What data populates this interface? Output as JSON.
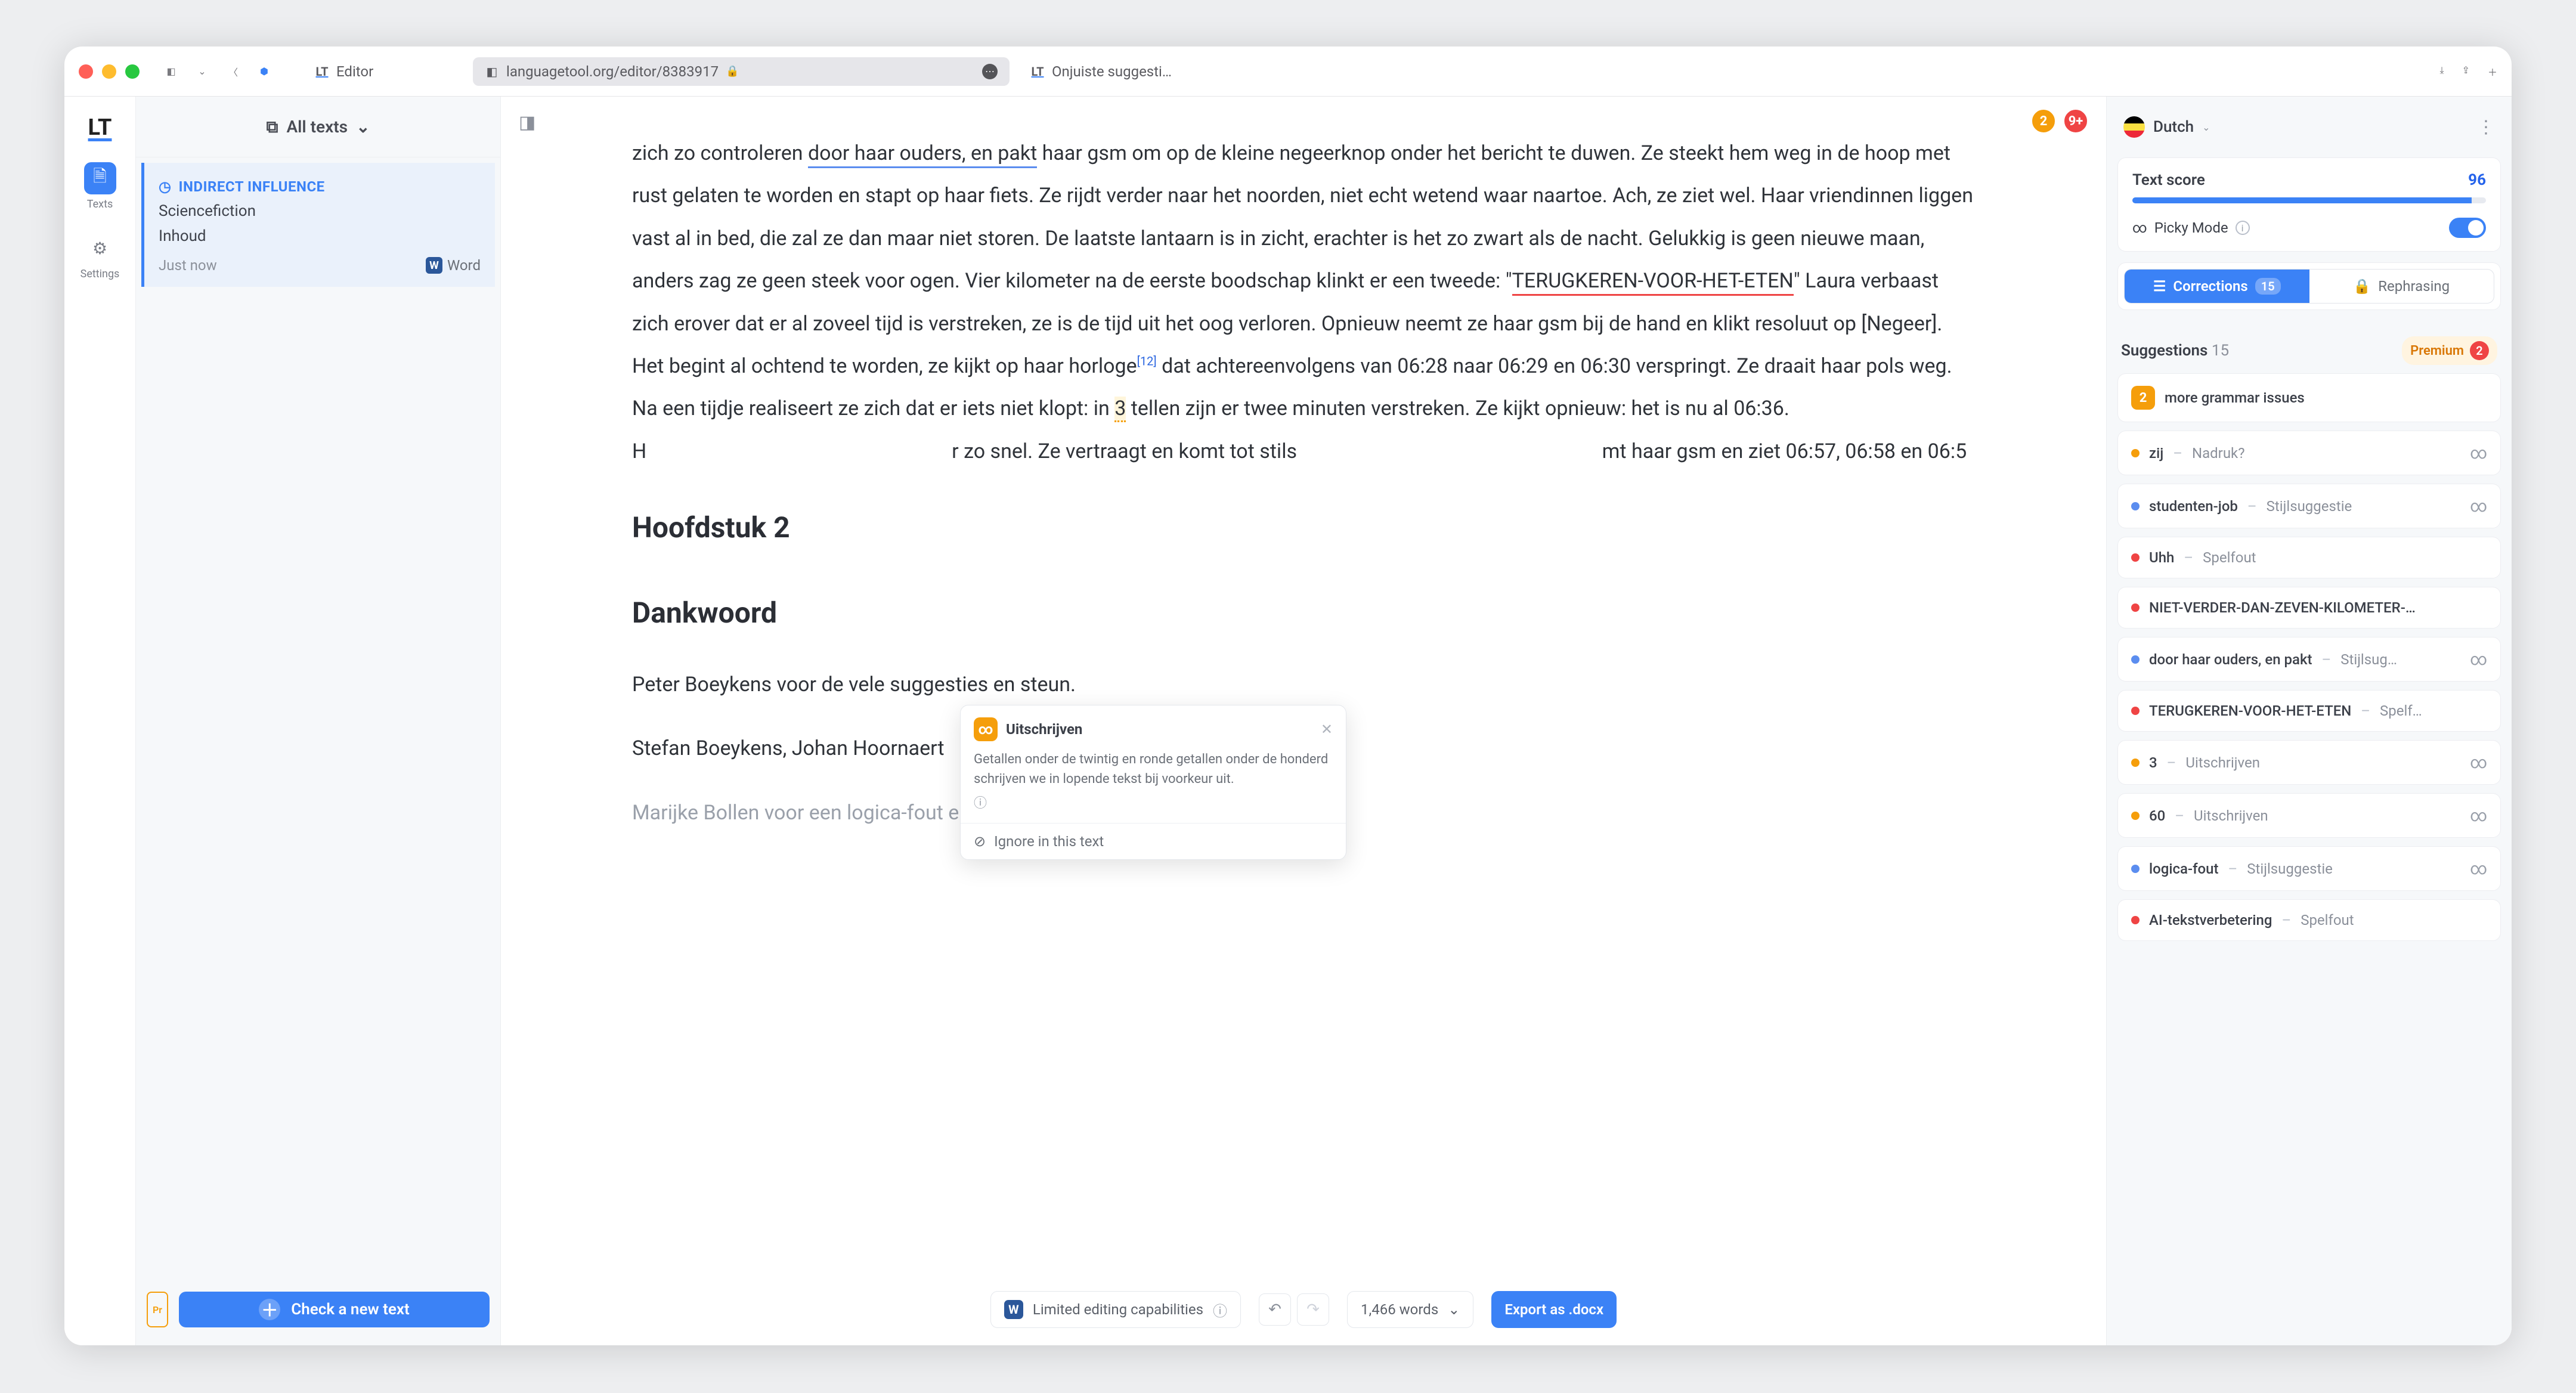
{
  "titlebar": {
    "tabs": [
      {
        "fav": "LT",
        "label": "Editor"
      },
      {
        "fav": "◧",
        "label": "languagetool.org/editor/8383917",
        "active": true,
        "lock": true
      },
      {
        "fav": "LT",
        "label": "Onjuiste suggesti…"
      }
    ]
  },
  "leftRail": {
    "logo": "LT",
    "items": [
      {
        "icon": "🗎",
        "label": "Texts",
        "active": true
      },
      {
        "icon": "⚙",
        "label": "Settings"
      }
    ]
  },
  "sidebar": {
    "headLabel": "All texts",
    "doc": {
      "title": "INDIRECT INFLUENCE",
      "line1": "Sciencefiction",
      "line2": "Inhoud",
      "time": "Just now",
      "source": "Word"
    },
    "prBadge": "Pr",
    "newText": "Check a new text"
  },
  "editor": {
    "counters": {
      "orange": "2",
      "red": "9+"
    },
    "para1_a": "zich zo controleren ",
    "para1_u": "door haar ouders, en pakt",
    "para1_b": " haar gsm om op de kleine negeerknop onder het bericht te duwen. Ze steekt hem weg in de hoop met rust gelaten te worden en stapt op haar fiets. Ze rijdt verder naar het noorden, niet echt wetend waar naartoe. Ach, ze ziet wel. Haar vriendinnen liggen vast al in bed, die zal ze dan maar niet storen. De laatste lantaarn is in zicht, erachter is het zo zwart als de nacht. Gelukkig is geen nieuwe maan, anders zag ze geen steek voor ogen. Vier kilometer na de eerste boodschap klinkt er een tweede: \"",
    "para1_r": "TERUGKEREN-VOOR-HET-ETEN",
    "para1_c": "\" Laura verbaast zich erover dat er al zoveel tijd is verstreken, ze is de tijd uit het oog verloren. Opnieuw neemt ze haar gsm bij de hand en klikt resoluut op [Negeer]. Het begint al ochtend te worden, ze kijkt op haar horloge",
    "para1_sup": "[12]",
    "para1_d": " dat achtereenvolgens van 06:28 naar 06:29 en 06:30 verspringt. Ze draait haar pols weg. Na een tijdje realiseert ze zich dat er iets niet klopt: in ",
    "para1_y": "3",
    "para1_e": " tellen zijn er twee minuten verstreken. Ze kijkt opnieuw: het is nu al 06:36. H",
    "para1_f": "r zo snel. Ze vertraagt en komt tot stils",
    "para1_g": "mt haar gsm en ziet 06:57, 06:58 en 06:5",
    "h2_1": "Hoofdstuk 2",
    "h2_2": "Dankwoord",
    "p2": "Peter Boeykens voor de vele suggesties en steun.",
    "p3": "Stefan Boeykens, Johan Hoornaert",
    "p4": "Marijke Bollen voor een logica-fout eruit te halen.",
    "popover": {
      "title": "Uitschrijven",
      "body": "Getallen onder de twintig en ronde getallen onder de honderd schrijven we in lopende tekst bij voorkeur uit.",
      "ignore": "Ignore in this text"
    },
    "bottom": {
      "limited": "Limited editing capabilities",
      "words": "1,466 words",
      "export": "Export as .docx"
    }
  },
  "right": {
    "lang": "Dutch",
    "scoreLabel": "Text score",
    "score": "96",
    "picky": "Picky Mode",
    "tabs": {
      "corrections": "Corrections",
      "corrN": "15",
      "rephr": "Rephrasing"
    },
    "sugHead": "Suggestions",
    "sugCount": "15",
    "premium": "Premium",
    "premN": "2",
    "items": [
      {
        "type": "badge",
        "n": "2",
        "main": "more grammar issues"
      },
      {
        "dot": "d-amb",
        "main": "zij",
        "hint": "Nadruk?",
        "inf": true
      },
      {
        "dot": "d-blue",
        "main": "studenten-job",
        "hint": "Stijlsuggestie",
        "inf": true
      },
      {
        "dot": "d-red",
        "main": "Uhh",
        "hint": "Spelfout"
      },
      {
        "dot": "d-red",
        "main": "NIET-VERDER-DAN-ZEVEN-KILOMETER-…"
      },
      {
        "dot": "d-blue",
        "main": "door haar ouders, en pakt",
        "hint": "Stijlsug…",
        "inf": true
      },
      {
        "dot": "d-red",
        "main": "TERUGKEREN-VOOR-HET-ETEN",
        "hint": "Spelf…"
      },
      {
        "dot": "d-amb",
        "main": "3",
        "hint": "Uitschrijven",
        "inf": true
      },
      {
        "dot": "d-amb",
        "main": "60",
        "hint": "Uitschrijven",
        "inf": true
      },
      {
        "dot": "d-blue",
        "main": "logica-fout",
        "hint": "Stijlsuggestie",
        "inf": true
      },
      {
        "dot": "d-red",
        "main": "AI-tekstverbetering",
        "hint": "Spelfout"
      }
    ]
  }
}
